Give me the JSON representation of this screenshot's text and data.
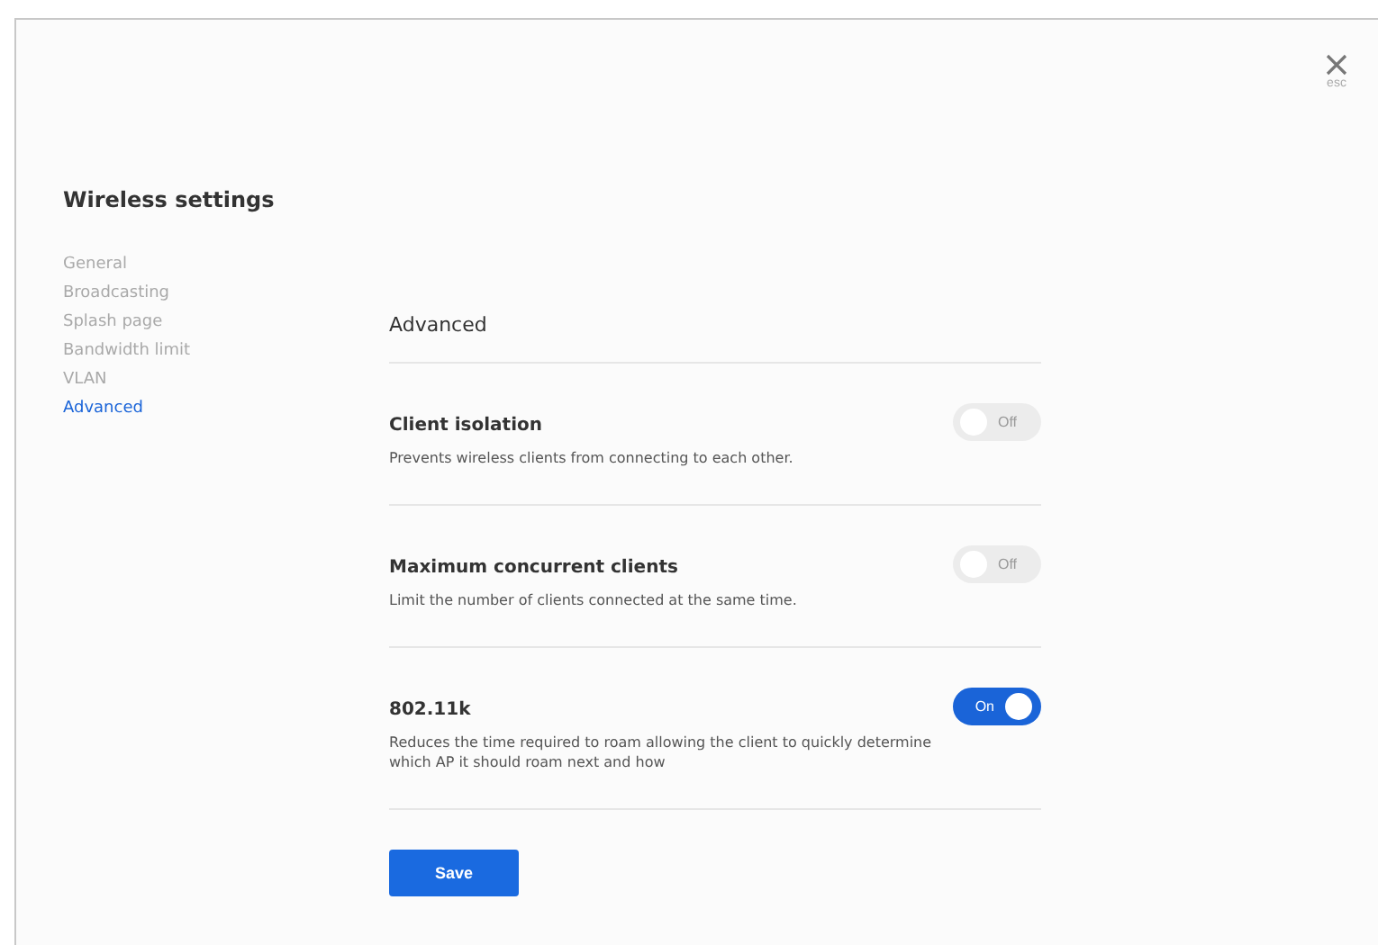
{
  "close": {
    "label": "esc"
  },
  "title": "Wireless settings",
  "sidebar": {
    "items": [
      {
        "label": "General",
        "selected": false
      },
      {
        "label": "Broadcasting",
        "selected": false
      },
      {
        "label": "Splash page",
        "selected": false
      },
      {
        "label": "Bandwidth limit",
        "selected": false
      },
      {
        "label": "VLAN",
        "selected": false
      },
      {
        "label": "Advanced",
        "selected": true
      }
    ]
  },
  "section": {
    "heading": "Advanced",
    "settings": [
      {
        "title": "Client isolation",
        "description": "Prevents wireless clients from connecting to each other.",
        "on": false,
        "toggle_label": "Off"
      },
      {
        "title": "Maximum concurrent clients",
        "description": "Limit the number of clients connected at the same time.",
        "on": false,
        "toggle_label": "Off"
      },
      {
        "title": "802.11k",
        "description": "Reduces the time required to roam allowing the client to quickly determine which AP it should roam next and how",
        "on": true,
        "toggle_label": "On"
      }
    ]
  },
  "save_button": "Save"
}
